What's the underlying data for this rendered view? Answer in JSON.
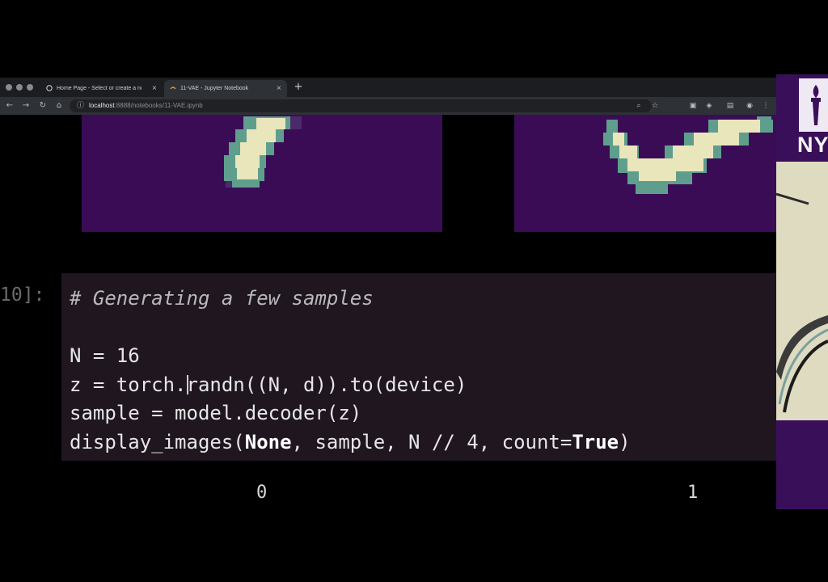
{
  "browser": {
    "tabs": [
      {
        "title": "Home Page - Select or create a no",
        "active": false
      },
      {
        "title": "11-VAE - Jupyter Notebook",
        "active": true
      }
    ],
    "new_tab_label": "+",
    "url_host": "localhost",
    "url_rest": ":8888/notebooks/11-VAE.ipynb",
    "nav_icons": [
      "back-icon",
      "forward-icon",
      "reload-icon",
      "home-icon"
    ],
    "toolbar_icons": [
      "zoom-icon",
      "bookmark-star-icon",
      "extension-icon",
      "extension-icon",
      "extension-icon",
      "extension-icon",
      "menu-icon"
    ]
  },
  "notebook": {
    "prompt": "10]:",
    "code_lines": {
      "line1": "# Generating a few samples",
      "line3a": "N = 16",
      "line4a": "z = torch.",
      "line4b": "randn((N, d)).to(device)",
      "line5": "sample = model.decoder(z)",
      "line6_pre": "display_images(",
      "line6_kw1": "None",
      "line6_mid": ", sample, N // 4, count=",
      "line6_kw2": "True",
      "line6_post": ")"
    },
    "output_labels": [
      "0",
      "1"
    ]
  },
  "side": {
    "logo_text": "NYU"
  },
  "colors": {
    "image_background": "#3b0c56",
    "digit_bright": "#e9e6bc",
    "digit_mid": "#5f9e8d",
    "code_cell_bg": "#1f1620",
    "brand_purple": "#3a0f59"
  }
}
